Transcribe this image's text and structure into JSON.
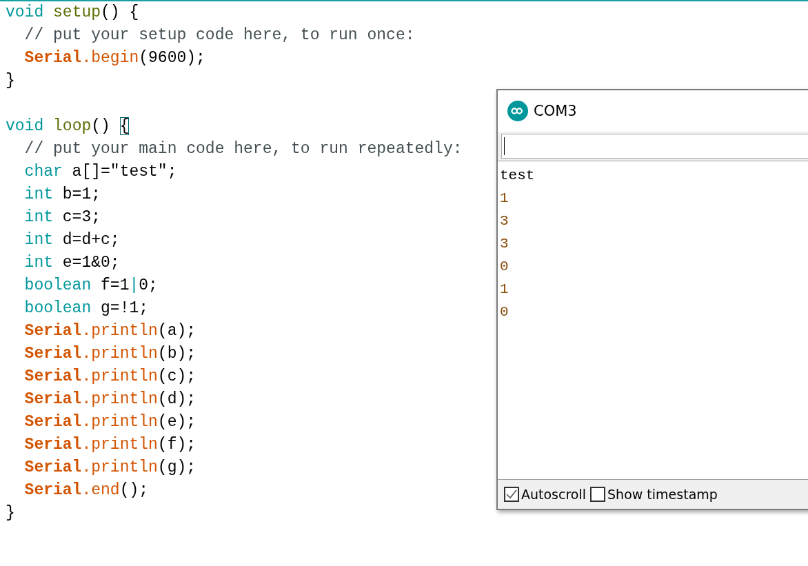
{
  "editor": {
    "lines": [
      {
        "kind": "code",
        "indent": false,
        "tokens": [
          {
            "text": "void",
            "kind": "type"
          },
          {
            "text": " setup",
            "kind": "func"
          },
          {
            "text": "() {",
            "kind": "plain"
          }
        ]
      },
      {
        "kind": "code",
        "indent": true,
        "tokens": [
          {
            "text": "// put your setup code here, to run once:",
            "kind": "comment"
          }
        ]
      },
      {
        "kind": "code",
        "indent": true,
        "tokens": [
          {
            "text": "Serial",
            "kind": "object"
          },
          {
            "text": ".begin",
            "kind": "method"
          },
          {
            "text": "(9600);",
            "kind": "plain"
          }
        ]
      },
      {
        "kind": "code",
        "indent": false,
        "tokens": [
          {
            "text": "}",
            "kind": "plain"
          }
        ]
      },
      {
        "kind": "blank"
      },
      {
        "kind": "code",
        "indent": false,
        "tokens": [
          {
            "text": "void",
            "kind": "type"
          },
          {
            "text": " loop",
            "kind": "func"
          },
          {
            "text": "() ",
            "kind": "plain"
          },
          {
            "text": "{",
            "kind": "bracket"
          }
        ]
      },
      {
        "kind": "code",
        "indent": true,
        "tokens": [
          {
            "text": "// put your main code here, to run repeatedly:",
            "kind": "comment"
          }
        ]
      },
      {
        "kind": "code",
        "indent": true,
        "tokens": [
          {
            "text": "char",
            "kind": "type"
          },
          {
            "text": " a[]=\"test\";",
            "kind": "plain"
          }
        ]
      },
      {
        "kind": "code",
        "indent": true,
        "tokens": [
          {
            "text": "int",
            "kind": "type"
          },
          {
            "text": " b=1;",
            "kind": "plain"
          }
        ]
      },
      {
        "kind": "code",
        "indent": true,
        "tokens": [
          {
            "text": "int",
            "kind": "type"
          },
          {
            "text": " c=3;",
            "kind": "plain"
          }
        ]
      },
      {
        "kind": "code",
        "indent": true,
        "tokens": [
          {
            "text": "int",
            "kind": "type"
          },
          {
            "text": " d=d+c;",
            "kind": "plain"
          }
        ]
      },
      {
        "kind": "code",
        "indent": true,
        "tokens": [
          {
            "text": "int",
            "kind": "type"
          },
          {
            "text": " e=1&0;",
            "kind": "plain"
          }
        ]
      },
      {
        "kind": "code",
        "indent": true,
        "tokens": [
          {
            "text": "boolean",
            "kind": "type"
          },
          {
            "text": " f=1",
            "kind": "plain"
          },
          {
            "text": "|",
            "kind": "type"
          },
          {
            "text": "0;",
            "kind": "plain"
          }
        ]
      },
      {
        "kind": "code",
        "indent": true,
        "tokens": [
          {
            "text": "boolean",
            "kind": "type"
          },
          {
            "text": " g=!1;",
            "kind": "plain"
          }
        ]
      },
      {
        "kind": "code",
        "indent": true,
        "tokens": [
          {
            "text": "Serial",
            "kind": "object"
          },
          {
            "text": ".println",
            "kind": "method"
          },
          {
            "text": "(a);",
            "kind": "plain"
          }
        ]
      },
      {
        "kind": "code",
        "indent": true,
        "tokens": [
          {
            "text": "Serial",
            "kind": "object"
          },
          {
            "text": ".println",
            "kind": "method"
          },
          {
            "text": "(b);",
            "kind": "plain"
          }
        ]
      },
      {
        "kind": "code",
        "indent": true,
        "tokens": [
          {
            "text": "Serial",
            "kind": "object"
          },
          {
            "text": ".println",
            "kind": "method"
          },
          {
            "text": "(c);",
            "kind": "plain"
          }
        ]
      },
      {
        "kind": "code",
        "indent": true,
        "tokens": [
          {
            "text": "Serial",
            "kind": "object"
          },
          {
            "text": ".println",
            "kind": "method"
          },
          {
            "text": "(d);",
            "kind": "plain"
          }
        ]
      },
      {
        "kind": "code",
        "indent": true,
        "tokens": [
          {
            "text": "Serial",
            "kind": "object"
          },
          {
            "text": ".println",
            "kind": "method"
          },
          {
            "text": "(e);",
            "kind": "plain"
          }
        ]
      },
      {
        "kind": "code",
        "indent": true,
        "tokens": [
          {
            "text": "Serial",
            "kind": "object"
          },
          {
            "text": ".println",
            "kind": "method"
          },
          {
            "text": "(f);",
            "kind": "plain"
          }
        ]
      },
      {
        "kind": "code",
        "indent": true,
        "tokens": [
          {
            "text": "Serial",
            "kind": "object"
          },
          {
            "text": ".println",
            "kind": "method"
          },
          {
            "text": "(g);",
            "kind": "plain"
          }
        ]
      },
      {
        "kind": "code",
        "indent": true,
        "tokens": [
          {
            "text": "Serial",
            "kind": "object"
          },
          {
            "text": ".end",
            "kind": "method"
          },
          {
            "text": "();",
            "kind": "plain"
          }
        ]
      },
      {
        "kind": "code",
        "indent": false,
        "tokens": [
          {
            "text": "}",
            "kind": "plain"
          }
        ]
      }
    ]
  },
  "serial_monitor": {
    "title": "COM3",
    "output": [
      {
        "text": "test",
        "kind": "text"
      },
      {
        "text": "1",
        "kind": "number"
      },
      {
        "text": "3",
        "kind": "number"
      },
      {
        "text": "3",
        "kind": "number"
      },
      {
        "text": "0",
        "kind": "number"
      },
      {
        "text": "1",
        "kind": "number"
      },
      {
        "text": "0",
        "kind": "number"
      }
    ],
    "options": [
      {
        "label": "Autoscroll",
        "checked": true
      },
      {
        "label": "Show timestamp",
        "checked": false
      }
    ]
  }
}
